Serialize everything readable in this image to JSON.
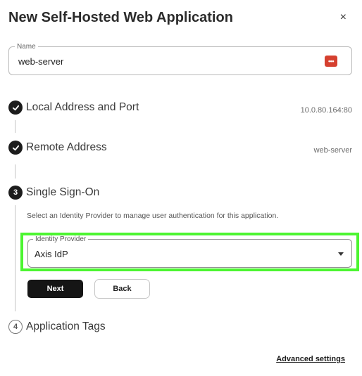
{
  "dialog": {
    "title": "New Self-Hosted Web Application",
    "close_glyph": "×"
  },
  "name_field": {
    "label": "Name",
    "value": "web-server",
    "icon": "password-manager-icon",
    "icon_color": "#d5402f"
  },
  "steps": [
    {
      "number": "1",
      "label": "Local Address and Port",
      "status": "complete",
      "value": "10.0.80.164:80"
    },
    {
      "number": "2",
      "label": "Remote Address",
      "status": "complete",
      "value": "web-server"
    },
    {
      "number": "3",
      "label": "Single Sign-On",
      "status": "active",
      "value": ""
    },
    {
      "number": "4",
      "label": "Application Tags",
      "status": "pending",
      "value": ""
    }
  ],
  "sso": {
    "help_text": "Select an Identity Provider to manage user authentication for this application.",
    "idp_label": "Identity Provider",
    "idp_value": "Axis IdP",
    "next_label": "Next",
    "back_label": "Back"
  },
  "footer": {
    "advanced_label": "Advanced settings"
  },
  "colors": {
    "highlight": "#4cf531",
    "primary_button": "#151515"
  }
}
